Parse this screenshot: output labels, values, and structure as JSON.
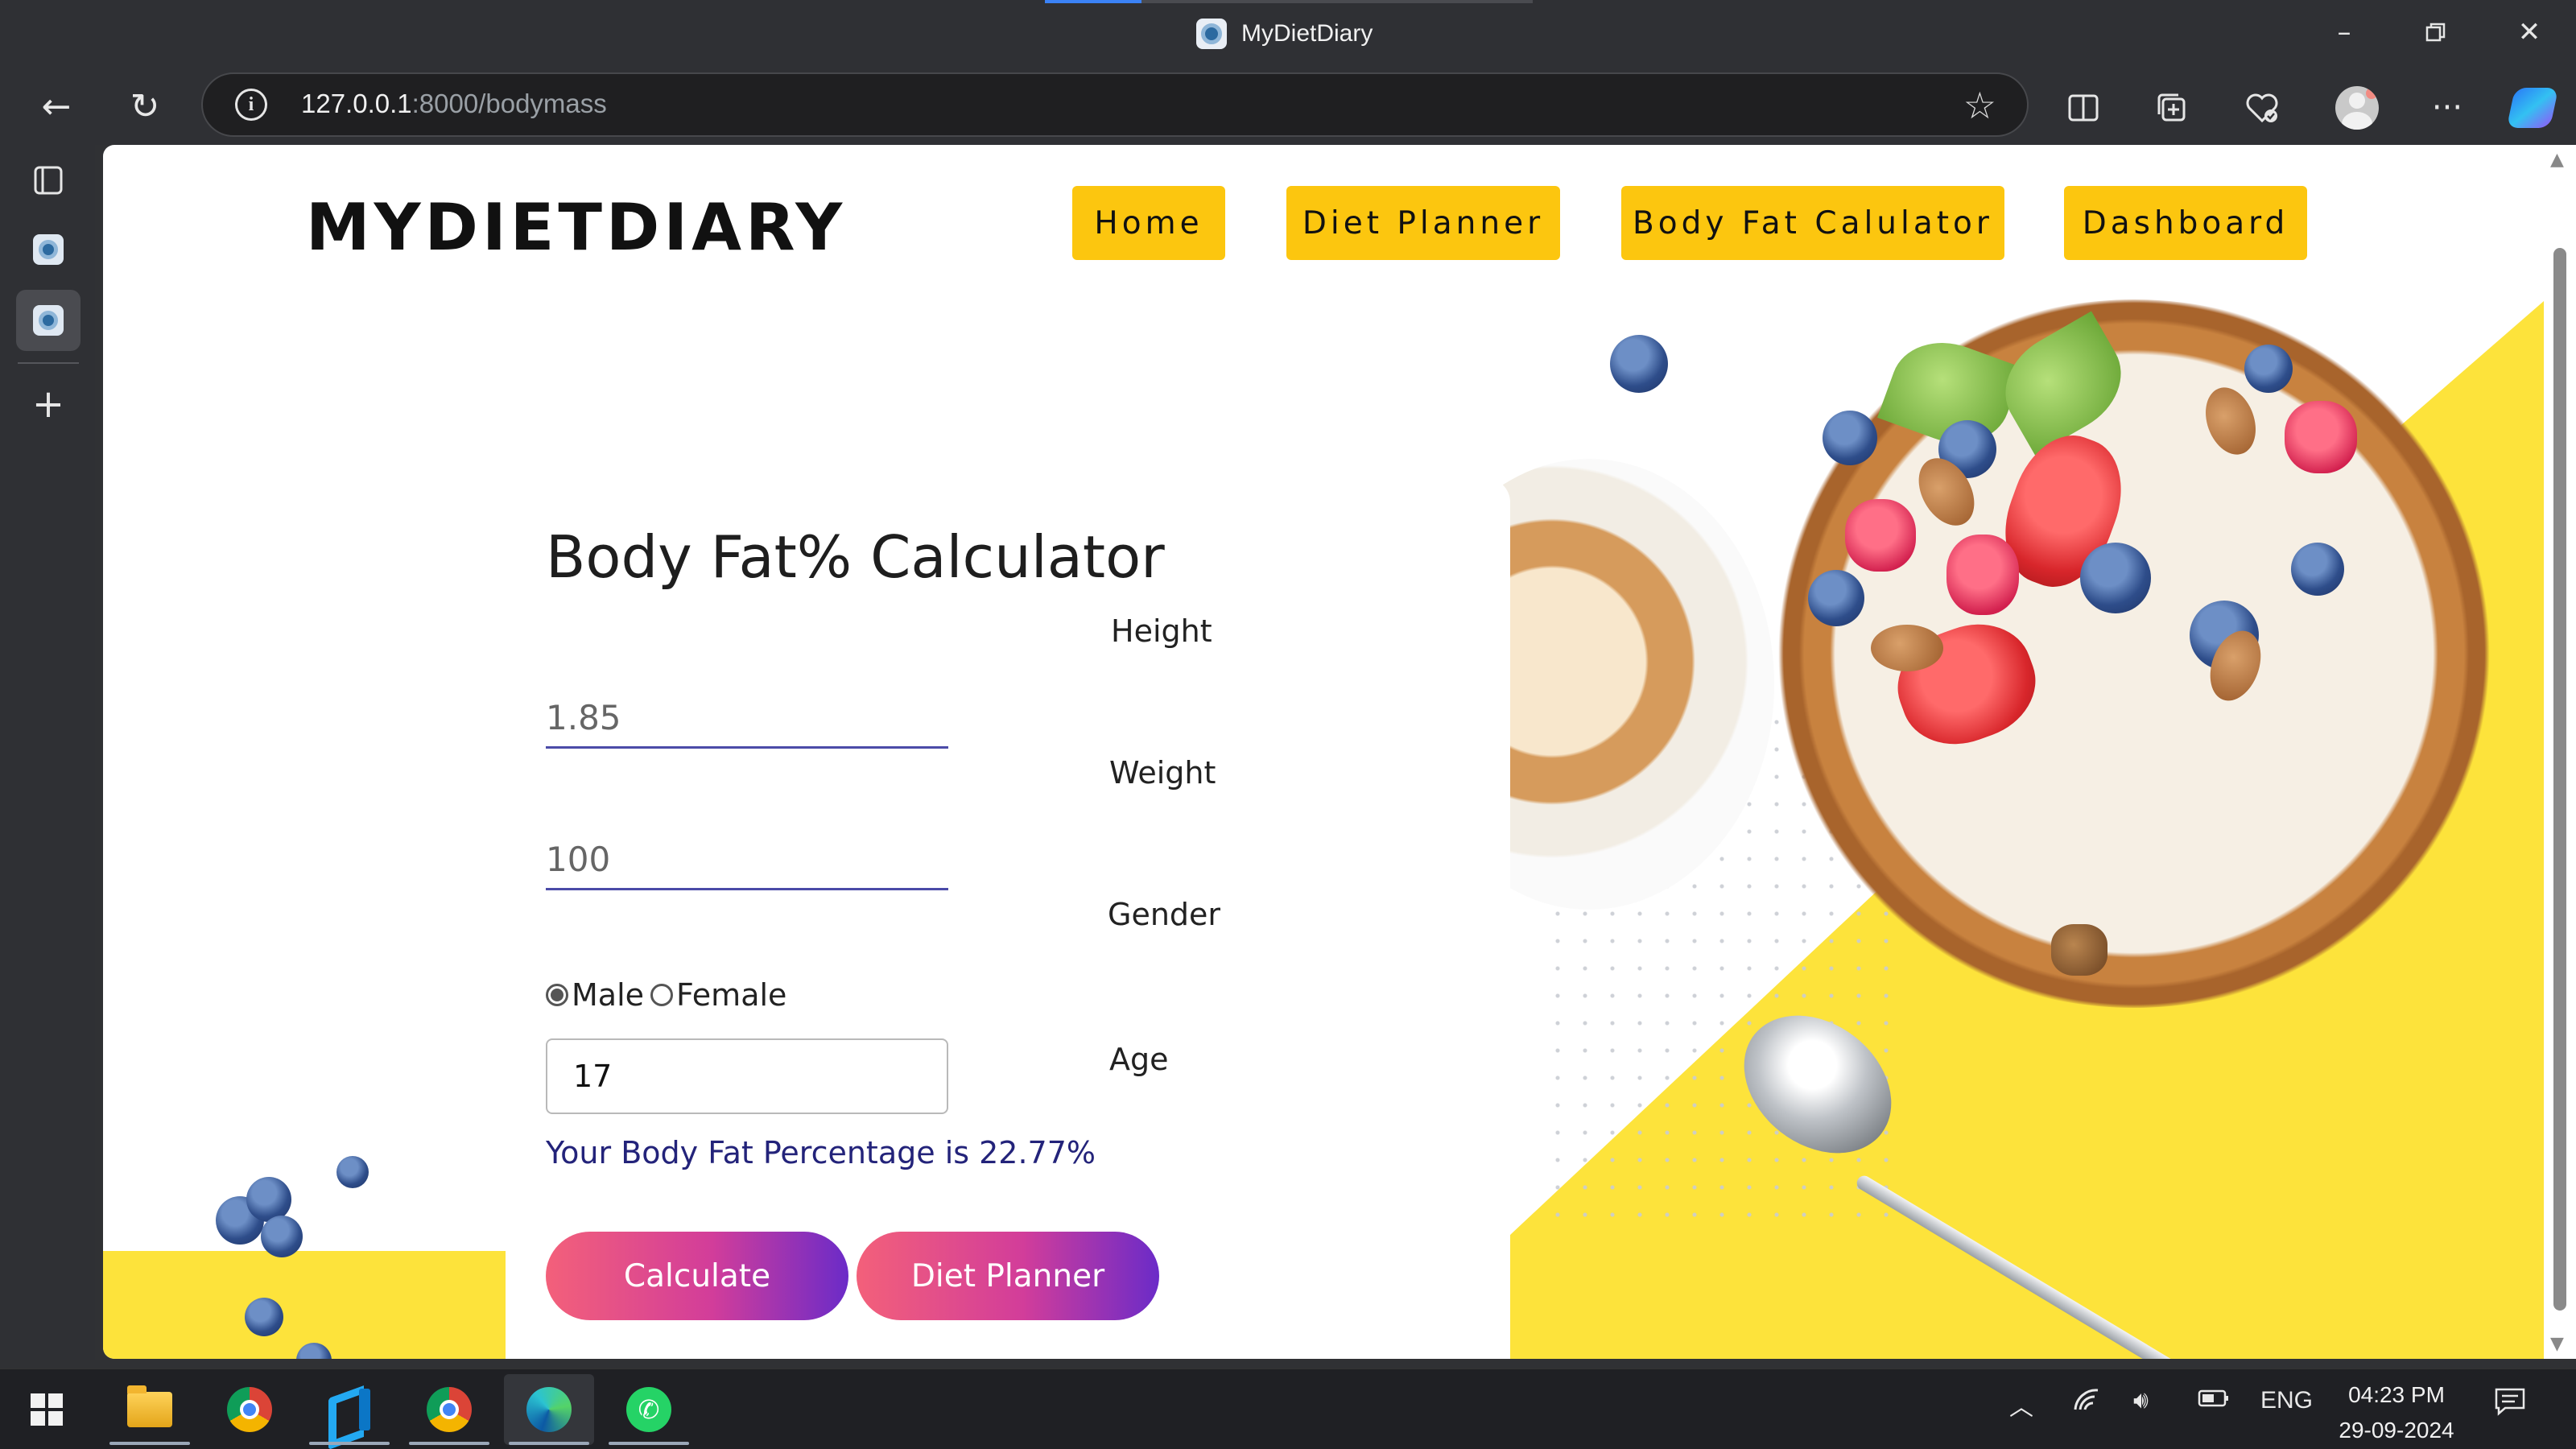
{
  "browser": {
    "window_title": "MyDietDiary",
    "url_host": "127.0.0.1",
    "url_path": ":8000/bodymass"
  },
  "site": {
    "brand": "MYDIETDIARY",
    "nav": [
      {
        "label": "Home"
      },
      {
        "label": "Diet Planner"
      },
      {
        "label": "Body Fat Calulator"
      },
      {
        "label": "Dashboard"
      }
    ]
  },
  "calculator": {
    "title": "Body Fat% Calculator",
    "height_label": "Height",
    "height_value": "1.85",
    "weight_label": "Weight",
    "weight_value": "100",
    "gender_label": "Gender",
    "gender_options": [
      {
        "label": "Male",
        "selected": true
      },
      {
        "label": "Female",
        "selected": false
      }
    ],
    "age_label": "Age",
    "age_value": "17",
    "result_text": "Your Body Fat Percentage is 22.77%",
    "calculate_button": "Calculate",
    "diet_planner_button": "Diet Planner"
  },
  "taskbar": {
    "language": "ENG",
    "time": "04:23 PM",
    "date": "29-09-2024",
    "apps": [
      "file-explorer",
      "chrome",
      "vscode",
      "chrome-profile",
      "edge",
      "whatsapp"
    ]
  },
  "colors": {
    "nav_button": "#fcc60f",
    "hero_yellow": "#fde33b",
    "result_text": "#23237a",
    "button_gradient_start": "#f3607a",
    "button_gradient_end": "#6b2bc8"
  }
}
